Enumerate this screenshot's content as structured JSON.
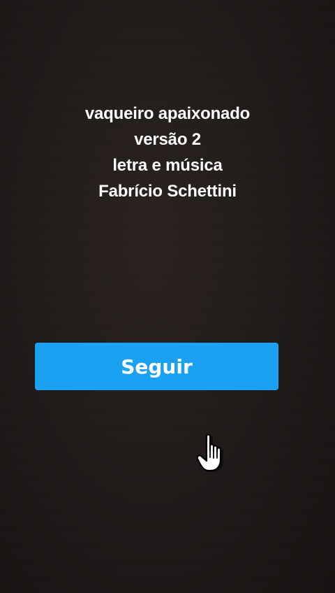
{
  "title_lines": [
    "vaqueiro apaixonado",
    "versão 2",
    "letra e música",
    "Fabrício Schettini"
  ],
  "follow_button": {
    "label": "Seguir",
    "color": "#1ba1f2"
  },
  "cursor": {
    "icon": "hand-pointer-icon"
  }
}
